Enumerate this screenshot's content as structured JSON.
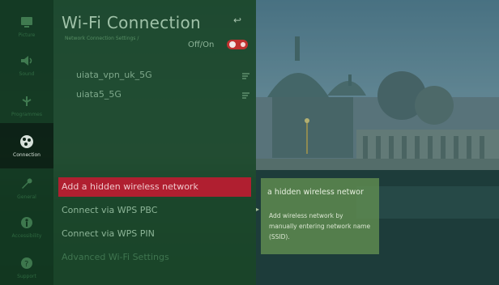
{
  "title": "Wi-Fi Connection",
  "breadcrumb": "Network Connection Settings /",
  "toggle_label": "Off/On",
  "toggle_state": "on",
  "back_glyph": "↩",
  "networks": [
    {
      "ssid": "uiata_vpn_uk_5G",
      "icon": "wifi-lock-icon"
    },
    {
      "ssid": "uiata5_5G",
      "icon": "wifi-lock-icon"
    }
  ],
  "menu": [
    {
      "label": "Add a hidden wireless network",
      "state": "selected"
    },
    {
      "label": "Connect via WPS PBC",
      "state": "normal"
    },
    {
      "label": "Connect via WPS PIN",
      "state": "normal"
    },
    {
      "label": "Advanced Wi-Fi Settings",
      "state": "dimmed"
    }
  ],
  "rail": [
    {
      "label": "Picture",
      "icon": "picture-icon"
    },
    {
      "label": "Sound",
      "icon": "speaker-icon"
    },
    {
      "label": "Programmes",
      "icon": "antenna-icon"
    },
    {
      "label": "Connection",
      "icon": "globe-icon",
      "active": true
    },
    {
      "label": "General",
      "icon": "wrench-icon"
    },
    {
      "label": "Accessibility",
      "icon": "accessibility-icon"
    },
    {
      "label": "Support",
      "icon": "support-icon"
    }
  ],
  "tooltip": {
    "title": "a hidden wireless networ",
    "body": "Add wireless network by manually entering network name (SSID)."
  },
  "colors": {
    "accent": "#b01f30",
    "panel": "#1a4628",
    "rail_active": "#0a1f12"
  }
}
